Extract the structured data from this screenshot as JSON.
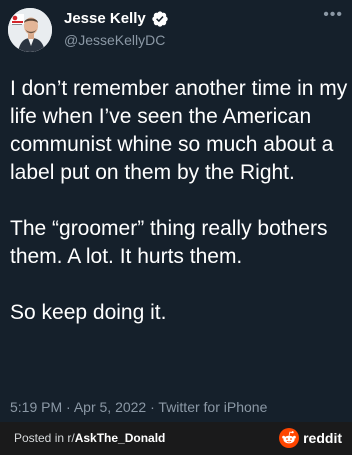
{
  "tweet": {
    "author": {
      "display_name": "Jesse Kelly",
      "handle": "@JesseKellyDC",
      "verified": true
    },
    "body": [
      "I don’t remember another time in my life when I’ve seen the American communist whine so much about a label put on them by the Right.",
      "The “groomer” thing really bothers them. A lot. It hurts them.",
      "So keep doing it."
    ],
    "time": "5:19 PM",
    "date": "Apr 5, 2022",
    "source": "Twitter for iPhone",
    "separator": "·"
  },
  "footer": {
    "prefix": "Posted in r/",
    "subreddit": "AskThe_Donald",
    "brand": "reddit"
  },
  "icons": {
    "verified": "verified-badge-icon",
    "more": "more-options-icon",
    "reddit": "reddit-snoo-icon"
  },
  "colors": {
    "background": "#15202b",
    "text": "#ffffff",
    "secondary_text": "#8b98a5",
    "verified_blue": "#1d9bf0",
    "footer_bg": "#1a1a1b",
    "reddit_orange": "#ff4500"
  }
}
